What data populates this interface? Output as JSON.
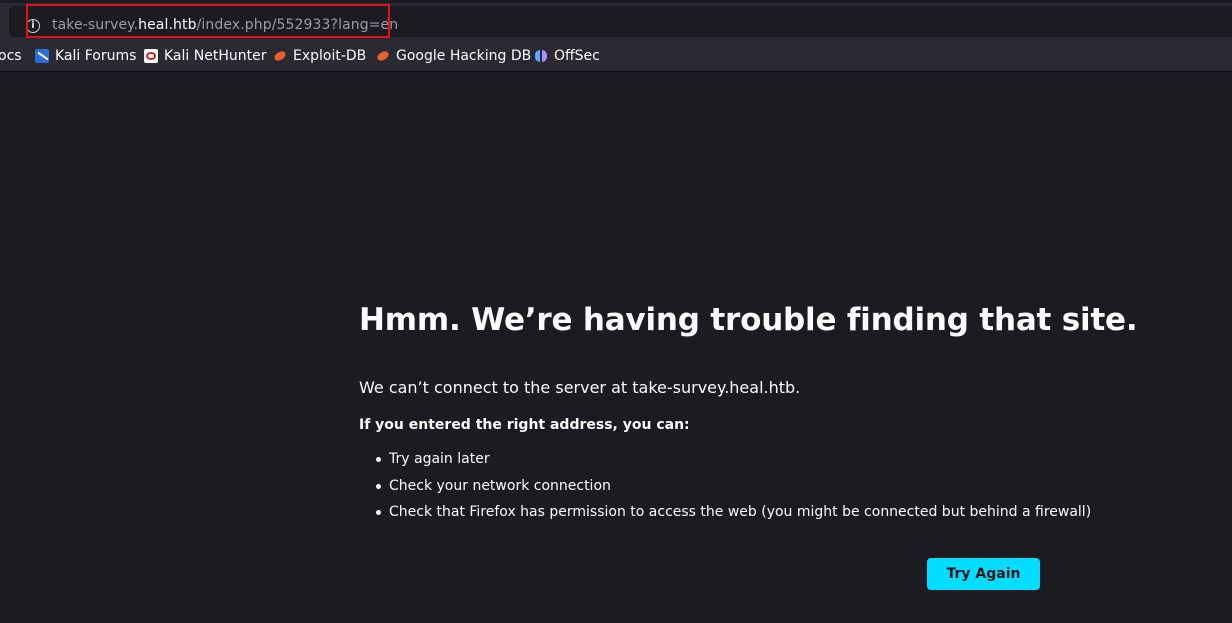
{
  "url_bar": {
    "prefix": "take-survey.",
    "host": "heal.htb",
    "path": "/index.php/552933?lang=en",
    "info_icon": "info-circle-icon"
  },
  "annotation": {
    "highlight_color": "#e0121b"
  },
  "bookmarks": [
    {
      "label": "ocs",
      "icon": "none"
    },
    {
      "label": "Kali Forums",
      "icon": "kali-icon"
    },
    {
      "label": "Kali NetHunter",
      "icon": "nethunter-icon"
    },
    {
      "label": "Exploit-DB",
      "icon": "exploit-db-icon"
    },
    {
      "label": "Google Hacking DB",
      "icon": "exploit-db-icon"
    },
    {
      "label": "OffSec",
      "icon": "offsec-icon"
    }
  ],
  "error_page": {
    "title": "Hmm. We’re having trouble finding that site.",
    "description": "We can’t connect to the server at take-survey.heal.htb.",
    "subtitle": "If you entered the right address, you can:",
    "suggestions": [
      "Try again later",
      "Check your network connection",
      "Check that Firefox has permission to access the web (you might be connected but behind a firewall)"
    ],
    "try_again_label": "Try Again",
    "button_color": "#00ddff"
  }
}
